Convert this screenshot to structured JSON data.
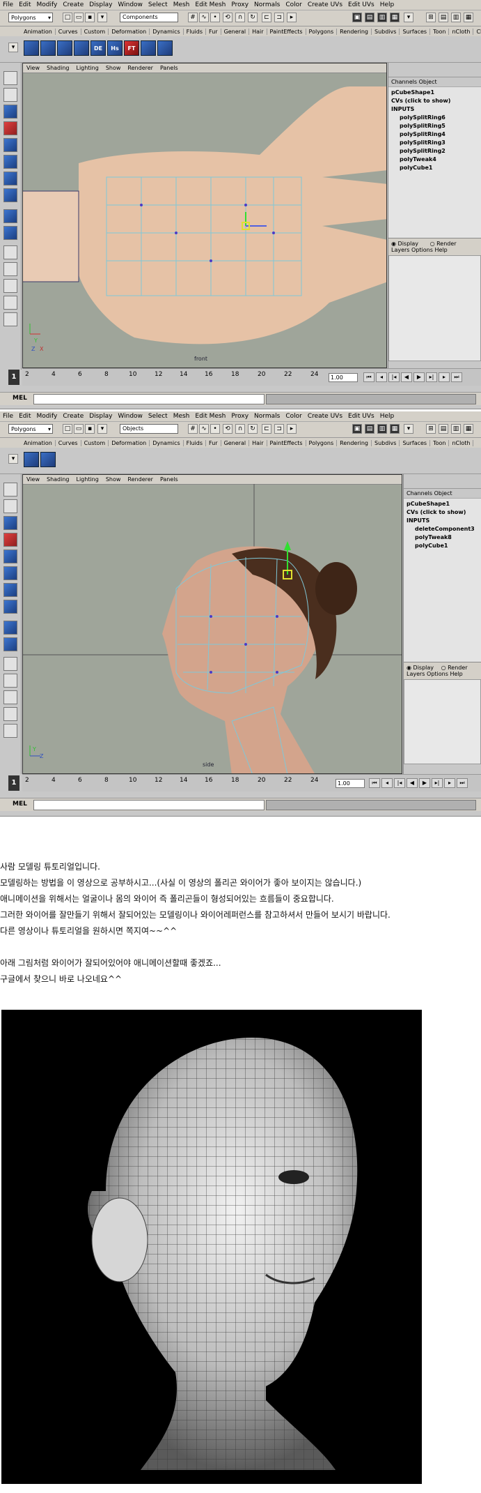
{
  "screenshot1": {
    "menu": [
      "File",
      "Edit",
      "Modify",
      "Create",
      "Display",
      "Window",
      "Select",
      "Mesh",
      "Edit Mesh",
      "Proxy",
      "Normals",
      "Color",
      "Create UVs",
      "Edit UVs",
      "Help"
    ],
    "mode": "Polygons",
    "selection_mask": "Components",
    "shelf_tabs": [
      "Animation",
      "Curves",
      "Custom",
      "Deformation",
      "Dynamics",
      "Fluids",
      "Fur",
      "General",
      "Hair",
      "PaintEffects",
      "Polygons",
      "Rendering",
      "Subdivs",
      "Surfaces",
      "Toon",
      "nCloth",
      "Claire"
    ],
    "shelf_icons": [
      "",
      "",
      "",
      "",
      "DE",
      "Hs",
      "FT",
      "",
      ""
    ],
    "viewport_menu": [
      "View",
      "Shading",
      "Lighting",
      "Show",
      "Renderer",
      "Panels"
    ],
    "camera_label": "front",
    "channel_box": {
      "tabs": [
        "Channels",
        "Object"
      ],
      "shape": "pCubeShape1",
      "cvs": "CVs (click to show)",
      "inputs_label": "INPUTS",
      "inputs": [
        "polySplitRing6",
        "polySplitRing5",
        "polySplitRing4",
        "polySplitRing3",
        "polySplitRing2",
        "polyTweak4",
        "polyCube1"
      ]
    },
    "layer_editor": {
      "display": "Display",
      "render": "Render",
      "menu": [
        "Layers",
        "Options",
        "Help"
      ]
    },
    "timeline_ticks": [
      "2",
      "4",
      "6",
      "8",
      "10",
      "12",
      "14",
      "16",
      "18",
      "20",
      "22",
      "24"
    ],
    "current_frame": "1",
    "range_value": "1.00",
    "mel_label": "MEL",
    "axis": {
      "x": "X",
      "y": "Y",
      "z": "Z"
    }
  },
  "screenshot2": {
    "menu": [
      "File",
      "Edit",
      "Modify",
      "Create",
      "Display",
      "Window",
      "Select",
      "Mesh",
      "Edit Mesh",
      "Proxy",
      "Normals",
      "Color",
      "Create UVs",
      "Edit UVs",
      "Help"
    ],
    "mode": "Polygons",
    "selection_mask": "Objects",
    "shelf_tabs": [
      "Animation",
      "Curves",
      "Custom",
      "Deformation",
      "Dynamics",
      "Fluids",
      "Fur",
      "General",
      "Hair",
      "PaintEffects",
      "Polygons",
      "Rendering",
      "Subdivs",
      "Surfaces",
      "Toon",
      "nCloth"
    ],
    "viewport_menu": [
      "View",
      "Shading",
      "Lighting",
      "Show",
      "Renderer",
      "Panels"
    ],
    "camera_label": "side",
    "channel_box": {
      "tabs": [
        "Channels",
        "Object"
      ],
      "shape": "pCubeShape1",
      "cvs": "CVs (click to show)",
      "inputs_label": "INPUTS",
      "inputs": [
        "deleteComponent3",
        "polyTweak8",
        "polyCube1"
      ]
    },
    "layer_editor": {
      "display": "Display",
      "render": "Render",
      "menu": [
        "Layers",
        "Options",
        "Help"
      ]
    },
    "timeline_ticks": [
      "2",
      "4",
      "6",
      "8",
      "10",
      "12",
      "14",
      "16",
      "18",
      "20",
      "22",
      "24"
    ],
    "current_frame": "1",
    "range_value": "1.00",
    "mel_label": "MEL",
    "axis": {
      "y": "Y",
      "z": "Z"
    }
  },
  "article": {
    "lines": [
      "사람 모델링 튜토리얼입니다.",
      "모델링하는 방법을 이 영상으로 공부하시고...(사실 이 영상의 폴리곤 와이어가 좋아 보이지는 않습니다.)",
      "애니메이션을 위해서는 얼굴이나 몸의 와이어 즉 폴리곤들이 형성되어있는 흐름들이 중요합니다.",
      "그러한 와이어를 잘만들기 위해서 잘되어있는 모델링이나 와이어레퍼런스를 참고하셔서 만들어 보시기 바랍니다.",
      "다른 영상이나 튜토리얼을 원하시면 쪽지여~~^^",
      "",
      "아래 그림처럼 와이어가 잘되어있어야 애니메이션할때 좋겠죠...",
      "구글에서 찾으니 바로 나오네요^^"
    ]
  }
}
